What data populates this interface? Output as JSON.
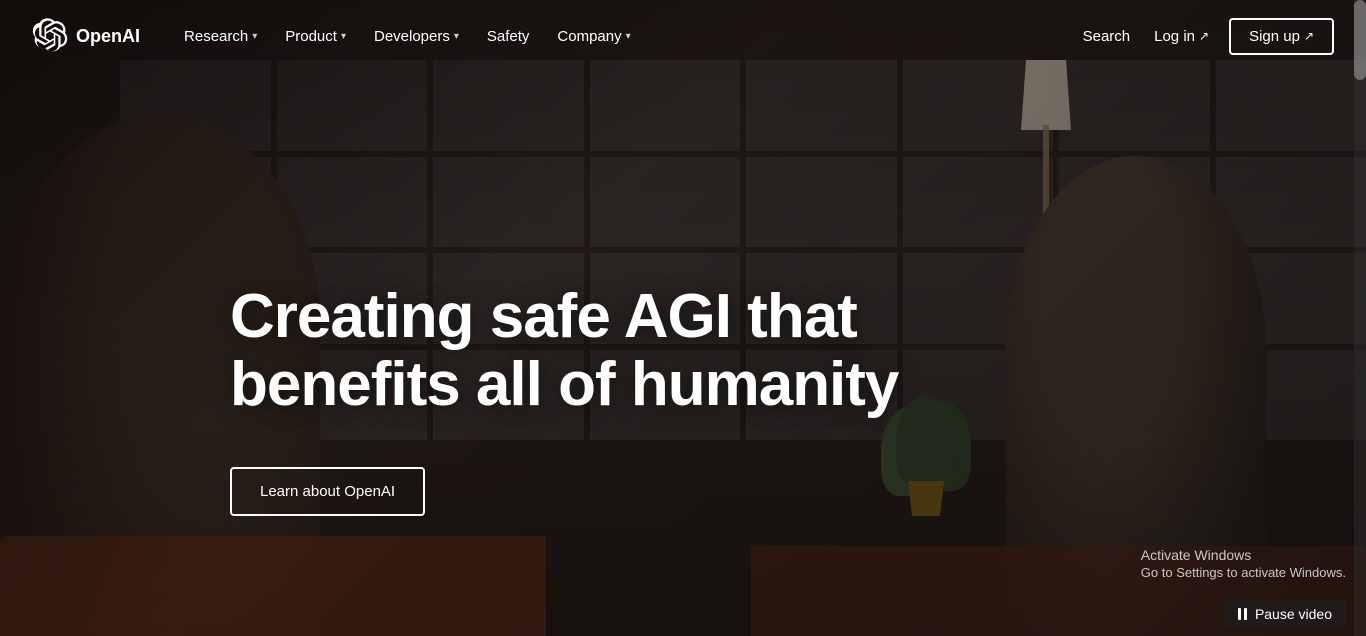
{
  "nav": {
    "logo_text": "OpenAI",
    "links": [
      {
        "label": "Research",
        "has_dropdown": true
      },
      {
        "label": "Product",
        "has_dropdown": true
      },
      {
        "label": "Developers",
        "has_dropdown": true
      },
      {
        "label": "Safety",
        "has_dropdown": false
      },
      {
        "label": "Company",
        "has_dropdown": true
      }
    ],
    "search_label": "Search",
    "login_label": "Log in",
    "login_icon": "↗",
    "signup_label": "Sign up",
    "signup_icon": "↗"
  },
  "hero": {
    "title_line1": "Creating safe AGI that",
    "title_line2": "benefits all of humanity",
    "cta_label": "Learn about OpenAI"
  },
  "activate_windows": {
    "title": "Activate Windows",
    "subtitle": "Go to Settings to activate Windows."
  },
  "video_controls": {
    "pause_label": "Pause video"
  }
}
